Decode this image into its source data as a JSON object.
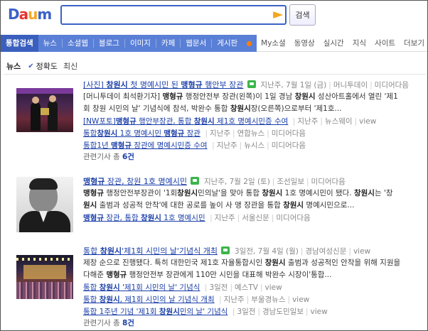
{
  "header": {
    "logo_letters": [
      {
        "ch": "D",
        "color": "#3c62c8"
      },
      {
        "ch": "a",
        "color": "#e8322c"
      },
      {
        "ch": "u",
        "color": "#f5a623"
      },
      {
        "ch": "m",
        "color": "#3c62c8"
      }
    ],
    "search_value": "",
    "search_button": "검색"
  },
  "nav": {
    "primary": [
      "통합검색",
      "뉴스",
      "소셜웹",
      "블로그",
      "이미지",
      "카페",
      "웹문서",
      "게시판"
    ],
    "secondary": [
      "My소셜",
      "동영상",
      "실시간",
      "지식",
      "사이트",
      "더보기"
    ]
  },
  "filter": {
    "title": "뉴스",
    "check": "✔",
    "options": [
      "정확도",
      "최신"
    ]
  },
  "news": [
    {
      "headline_pre": "[사진] ",
      "headline_b1": "창원시",
      "headline_mid": " 첫 명예시민 된 ",
      "headline_b2": "맹형규",
      "headline_post": " 행안부 장관",
      "meta": [
        "지난주, 7월 1일 (금)",
        "머니투데이",
        "미디어다음"
      ],
      "body1_pre": "[머니투데이 최석환기자] ",
      "body1_b1": "맹형규",
      "body1_mid": " 행정안전부 장관(왼쪽)이 1일 경남 ",
      "body1_b2": "창원시",
      "body1_post": " 성산아트홀에서 열린 '제1",
      "body2_pre": "회 창원 시민의 날' 기념식에 참석, 박완수 통합 ",
      "body2_b1": "창원시",
      "body2_post": "장(오른쪽)으로부터 '제1호...",
      "subs": [
        {
          "text_pre": "[NW포토]",
          "b1": "맹형규",
          "mid": " 행안부장관, 통합 ",
          "b2": "창원시",
          "post": " 제1호 명예시민증 수여",
          "meta": [
            "지난주",
            "뉴스웨이",
            "view"
          ]
        },
        {
          "text_pre": "통합",
          "b1": "시",
          "mid": " 1호 명예시민 ",
          "b2": "맹형규",
          "post": " 장관",
          "meta": [
            "지난주",
            "연합뉴스",
            "미디어다음"
          ]
        },
        {
          "text_pre": "통합1년 ",
          "b1": "맹형규",
          "mid": " 장관에 명예시민증 수여",
          "b2": "",
          "post": "",
          "meta": [
            "지난주",
            "뉴시스",
            "미디어다음"
          ]
        }
      ],
      "related_pre": "관련기사 총 ",
      "related_count": "6건"
    },
    {
      "headline_b1": "맹형규",
      "headline_mid": " 장관, 창원 1호 명예시민",
      "meta": [
        "지난주, 7월 2일 (토)",
        "조선일보",
        "미디어다음"
      ],
      "body1_b1": "맹형규",
      "body1_mid": " 행정안전부장관이 '1회",
      "body1_b2": "창원시",
      "body1_mid2": "민의날'을 맞아 통합 ",
      "body1_b3": "창원시",
      "body1_mid3": " 1호 명예시민이 됐다. ",
      "body1_b4": "창원시",
      "body1_post": "는 '창",
      "body2_b1": "원시",
      "body2_mid": " 출범과 성공적 안착'에 대한 공로를 높이 사 맹 장관을 통합 ",
      "body2_b2": "창원시",
      "body2_post": " 명예시민으로...",
      "sub": {
        "b1": "맹형규",
        "mid": " 장관, 통합 ",
        "b2": "창원시",
        "post": " 1호 명예시민",
        "meta": [
          "지난주",
          "서울신문",
          "미디어다음"
        ]
      }
    },
    {
      "headline_pre": "통합 ",
      "headline_b1": "창원시",
      "headline_post": "'제1회 시민의 날'기념식 개최",
      "meta": [
        "3일전, 7월 4일 (월)",
        "경남여성신문",
        "view"
      ],
      "body1": "제창 순으로 진행됐다. 특히 대한민국 제1호 자율통합시인 ",
      "body1_b1": "창원시",
      "body1_post": " 출범과 성공적인 안착을 위해 지원을",
      "body2_pre": "다해준 ",
      "body2_b1": "맹형규",
      "body2_post": " 행정안전부 장관에게 110만 시민을 대표해 박완수 시장이'통합...",
      "subs": [
        {
          "pre": "통합 ",
          "b1": "창원시",
          "post": " '제1회 시민의 날' 기념식",
          "meta": [
            "3일전",
            "예스TV",
            "view"
          ]
        },
        {
          "pre": "통합 ",
          "b1": "창원시",
          "post": ", 제1회 시민의 날 기념식 개최",
          "meta": [
            "지난주",
            "부울경뉴스",
            "view"
          ]
        },
        {
          "pre": "통합 1주년 기념 '제1회 ",
          "b1": "창원시",
          "post": "민의 날' 기념식",
          "meta": [
            "3일전",
            "경남도민일보",
            "view"
          ]
        }
      ],
      "related_pre": "관련기사 총 ",
      "related_count": "8건"
    }
  ]
}
